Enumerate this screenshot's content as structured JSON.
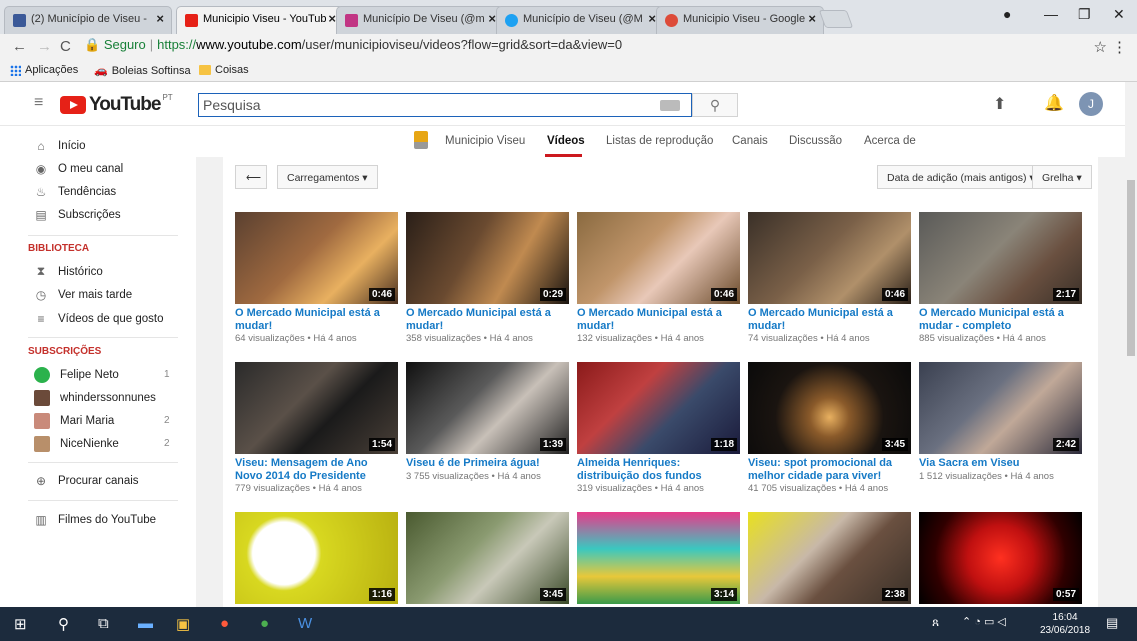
{
  "browser": {
    "tabs": [
      {
        "title": "(2) Município de Viseu -",
        "color": "#3b5998"
      },
      {
        "title": "Municipio Viseu - YouTub",
        "color": "#e62117"
      },
      {
        "title": "Município De Viseu (@m",
        "color": "#c13584"
      },
      {
        "title": "Município de Viseu (@M",
        "color": "#1da1f2"
      },
      {
        "title": "Municipio Viseu - Google",
        "color": "#dd4b39"
      }
    ],
    "url_secure": "Seguro",
    "url_scheme": "https://",
    "url_host": "www.youtube.com",
    "url_path": "/user/municipioviseu/videos?flow=grid&sort=da&view=0",
    "bookmarks": [
      "Aplicações",
      "Boleias Softinsa",
      "Coisas"
    ]
  },
  "youtube": {
    "wordmark": "YouTube",
    "country": "PT",
    "search_placeholder": "Pesquisa",
    "avatar_letter": "J"
  },
  "sidebar": {
    "main_items": [
      {
        "label": "Início",
        "icon": "home-icon"
      },
      {
        "label": "O meu canal",
        "icon": "account-icon"
      },
      {
        "label": "Tendências",
        "icon": "flame-icon"
      },
      {
        "label": "Subscrições",
        "icon": "subscriptions-icon"
      }
    ],
    "library_heading": "BIBLIOTECA",
    "library_items": [
      {
        "label": "Histórico",
        "icon": "hourglass-icon"
      },
      {
        "label": "Ver mais tarde",
        "icon": "clock-icon"
      },
      {
        "label": "Vídeos de que gosto",
        "icon": "list-icon"
      }
    ],
    "subs_heading": "SUBSCRIÇÕES",
    "subscriptions": [
      {
        "label": "Felipe Neto",
        "count": "1",
        "color": "#2bb24c"
      },
      {
        "label": "whinderssonnunes",
        "count": "",
        "color": "#6b4a3a"
      },
      {
        "label": "Mari Maria",
        "count": "2",
        "color": "#c98a7a"
      },
      {
        "label": "NiceNienke",
        "count": "2",
        "color": "#b88f6a"
      }
    ],
    "browse_channels": "Procurar canais",
    "youtube_movies": "Filmes do YouTube"
  },
  "channel": {
    "name": "Municipio Viseu",
    "tabs": [
      "Vídeos",
      "Listas de reprodução",
      "Canais",
      "Discussão",
      "Acerca de"
    ]
  },
  "controls": {
    "uploads": "Carregamentos",
    "sort": "Data de adição (mais antigos)",
    "view": "Grelha"
  },
  "videos": [
    {
      "title": "O Mercado Municipal está a mudar!",
      "views": "64 visualizações",
      "age": "Há 4 anos",
      "duration": "0:46",
      "bg": "linear-gradient(135deg,#5a4030 0%,#a06a40 45%,#e8b060 70%,#4a3020 100%)"
    },
    {
      "title": "O Mercado Municipal está a mudar!",
      "views": "358 visualizações",
      "age": "Há 4 anos",
      "duration": "0:29",
      "bg": "linear-gradient(120deg,#2a1f18 0%,#6a4a30 40%,#c08a50 65%,#1a1410 100%)"
    },
    {
      "title": "O Mercado Municipal está a mudar!",
      "views": "132 visualizações",
      "age": "Há 4 anos",
      "duration": "0:46",
      "bg": "linear-gradient(135deg,#8a6a40 0%,#c0956a 40%,#e8c8b8 60%,#6a4a2a 100%)"
    },
    {
      "title": "O Mercado Municipal está a mudar!",
      "views": "74 visualizações",
      "age": "Há 4 anos",
      "duration": "0:46",
      "bg": "linear-gradient(135deg,#3a3028 0%,#7a6048 45%,#b0906a 70%,#2a2018 100%)"
    },
    {
      "title": "O Mercado Municipal está a mudar - completo",
      "views": "885 visualizações",
      "age": "Há 4 anos",
      "duration": "2:17",
      "bg": "linear-gradient(135deg,#5a5a58 0%,#8a8478 45%,#6a5040 70%,#3a3028 100%)"
    },
    {
      "title": "Viseu: Mensagem de Ano Novo 2014 do Presidente",
      "views": "779 visualizações",
      "age": "Há 4 anos",
      "duration": "1:54",
      "bg": "linear-gradient(135deg,#2a2a2a 0%,#5a5048 40%,#1a1a1a 60%,#4a4038 100%)"
    },
    {
      "title": "Viseu é de Primeira água!",
      "views": "3 755 visualizações",
      "age": "Há 4 anos",
      "duration": "1:39",
      "bg": "linear-gradient(135deg,#101010 0%,#5a5a5a 40%,#c8c0b8 60%,#202020 100%)"
    },
    {
      "title": "Almeida Henriques: distribuição dos fundos comunitários",
      "views": "319 visualizações",
      "age": "Há 4 anos",
      "duration": "1:18",
      "bg": "linear-gradient(135deg,#8a1a1a 0%,#c04040 35%,#3a4a6a 60%,#1a1a3a 100%)"
    },
    {
      "title": "Viseu: spot promocional da melhor cidade para viver!",
      "views": "41 705 visualizações",
      "age": "Há 4 anos",
      "duration": "3:45",
      "bg": "radial-gradient(circle at 50% 60%,#e8b060 0%,#8a5a2a 20%,#1a1410 55%,#0a0a0a 100%)"
    },
    {
      "title": "Via Sacra em Viseu",
      "views": "1 512 visualizações",
      "age": "Há 4 anos",
      "duration": "2:42",
      "bg": "linear-gradient(135deg,#3a4050 0%,#6a7080 40%,#c0a898 60%,#2a2a3a 100%)"
    },
    {
      "title": "",
      "views": "",
      "age": "",
      "duration": "1:16",
      "bg": "radial-gradient(circle at 30% 45%,#ffffff 0%,#ffffff 25%,#d8d820 30%,#b8b010 100%)"
    },
    {
      "title": "",
      "views": "",
      "age": "",
      "duration": "3:45",
      "bg": "linear-gradient(135deg,#4a5a30 0%,#8a9a70 40%,#c8c8b8 60%,#3a4a28 100%)"
    },
    {
      "title": "",
      "views": "",
      "age": "",
      "duration": "3:14",
      "bg": "linear-gradient(180deg,#e83a8a 0%,#3ac8c0 40%,#e8c83a 70%,#3a9a4a 100%)"
    },
    {
      "title": "",
      "views": "",
      "age": "",
      "duration": "2:38",
      "bg": "linear-gradient(135deg,#e8e020 0%,#c8b8a8 40%,#6a5040 60%,#3a3028 100%)"
    },
    {
      "title": "",
      "views": "",
      "age": "",
      "duration": "0:57",
      "bg": "radial-gradient(circle at 50% 50%,#ff3020 0%,#c01010 35%,#300000 70%,#000 100%)"
    }
  ],
  "taskbar": {
    "time": "16:04",
    "date": "23/06/2018"
  }
}
